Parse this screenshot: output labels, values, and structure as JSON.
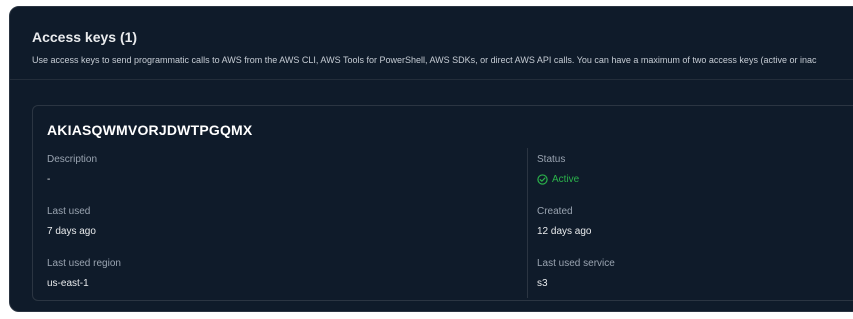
{
  "section": {
    "title": "Access keys (1)",
    "description": "Use access keys to send programmatic calls to AWS from the AWS CLI, AWS Tools for PowerShell, AWS SDKs, or direct AWS API calls. You can have a maximum of two access keys (active or inac"
  },
  "key": {
    "id": "AKIASQWMVORJDWTPGQMX",
    "description_label": "Description",
    "description_value": "-",
    "status_label": "Status",
    "status_value": "Active",
    "last_used_label": "Last used",
    "last_used_value": "7 days ago",
    "created_label": "Created",
    "created_value": "12 days ago",
    "last_used_region_label": "Last used region",
    "last_used_region_value": "us-east-1",
    "last_used_service_label": "Last used service",
    "last_used_service_value": "s3"
  },
  "colors": {
    "panel_bg": "#0f1b2a",
    "status_active": "#2bb34b",
    "text_primary": "#e9ebed",
    "text_secondary": "#9aa4b1"
  },
  "icons": {
    "status": "check-circle-icon"
  }
}
